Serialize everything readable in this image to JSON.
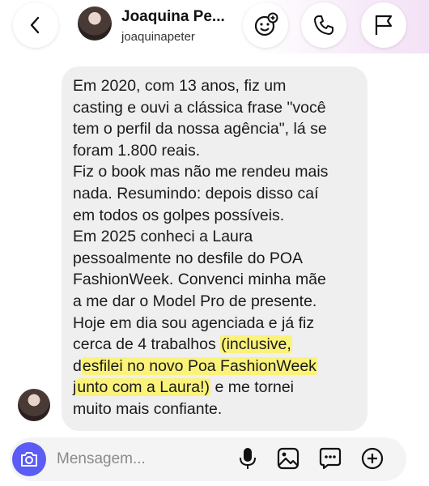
{
  "header": {
    "name": "Joaquina Pe...",
    "username": "joaquinapeter"
  },
  "message": {
    "lines": [
      "Em 2020, com 13 anos, fiz um",
      "casting e ouvi a clássica frase \"você",
      "tem o perfil da nossa agência\", lá se",
      "foram 1.800 reais.",
      "Fiz o book mas não me rendeu mais",
      "nada. Resumindo: depois disso caí",
      "em todos os golpes possíveis.",
      "Em 2025 conheci a Laura",
      "pessoalmente no desfile do POA",
      "FashionWeek. Convenci minha mãe",
      "a me dar o Model Pro de presente.",
      "Hoje em dia sou agenciada e já fiz"
    ],
    "line13_plain": "cerca de 4 trabalhos ",
    "line13_highlight": "(inclusive,",
    "line14_plain": "d",
    "line14_highlight": "esfilei no novo Poa FashionWeek",
    "line15_plain": "j",
    "line15_highlight": "unto com a Laura!)",
    "line15_tail": " e me tornei",
    "line16": "muito mais confiante."
  },
  "composer": {
    "placeholder": "Mensagem..."
  },
  "colors": {
    "highlight": "#fbf27a",
    "camera": "#5b5bf5",
    "bubble": "#efefef"
  },
  "icons": [
    "back-chevron-icon",
    "add-emoji-icon",
    "phone-icon",
    "flag-icon",
    "camera-icon",
    "microphone-icon",
    "gallery-icon",
    "sticker-icon",
    "plus-icon"
  ]
}
